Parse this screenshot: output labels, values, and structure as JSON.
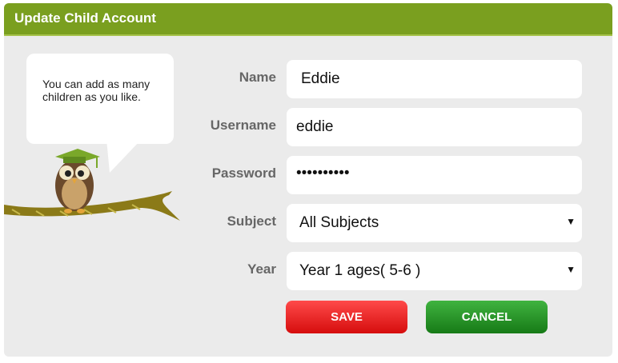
{
  "header": {
    "title": "Update Child Account"
  },
  "tip": {
    "text": "You can add as many children as you like."
  },
  "form": {
    "name": {
      "label": "Name",
      "value": "Eddie"
    },
    "username": {
      "label": "Username",
      "value": "eddie"
    },
    "password": {
      "label": "Password",
      "value": "••••••••••"
    },
    "subject": {
      "label": "Subject",
      "value": "All Subjects"
    },
    "year": {
      "label": "Year",
      "value": "Year 1 ages( 5-6 )"
    }
  },
  "buttons": {
    "save": "SAVE",
    "cancel": "CANCEL"
  },
  "icons": {
    "dropdown": "chevron-down-icon",
    "mascot": "owl-graduate-icon"
  },
  "colors": {
    "header": "#7a9f1f",
    "save": "#e31b1b",
    "cancel": "#2e9a2e"
  }
}
